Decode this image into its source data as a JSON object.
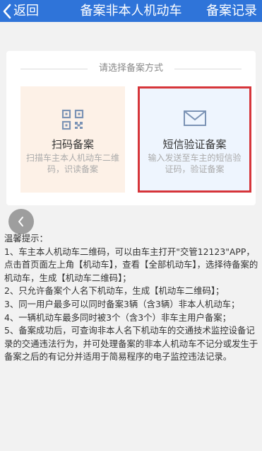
{
  "navbar": {
    "back_label": "返回",
    "title": "备案非本人机动车",
    "records_label": "备案记录",
    "back_icon": "chevron-left-icon",
    "bg_color": "#2f74d9"
  },
  "card": {
    "section_label": "请选择备案方式",
    "options": [
      {
        "icon": "qr-code-icon",
        "title": "扫码备案",
        "desc": "扫描车主本人机动车二维码，识读备案",
        "bg_color": "#fdf1e7"
      },
      {
        "icon": "envelope-icon",
        "title": "短信验证备案",
        "desc": "输入发送至车主的短信验证码，验证备案",
        "bg_color": "#eef5fe",
        "highlight_color": "#d6353a"
      }
    ]
  },
  "float_button": {
    "icon": "chevron-left-icon"
  },
  "tips": {
    "title": "温馨提示：",
    "items": [
      "1、车主本人机动车二维码，可以由车主打开\"交管12123\"APP，点击首页面左上角【机动车】，查看【全部机动车】，选择待备案的机动车，生成【机动车二维码】；",
      "2、只允许备案个人名下机动车，生成【机动车二维码】；",
      "3、同一用户最多可以同时备案3辆（含3辆）非本人机动车；",
      "4、一辆机动车最多同时被3个（含3个）非车主用户备案；",
      "5、备案成功后，可查询非本人名下机动车的交通技术监控设备记录的交通违法行为，并可处理备案的非本人机动车不记分或发生于备案之后的有记分并适用于简易程序的电子监控违法记录。"
    ]
  }
}
